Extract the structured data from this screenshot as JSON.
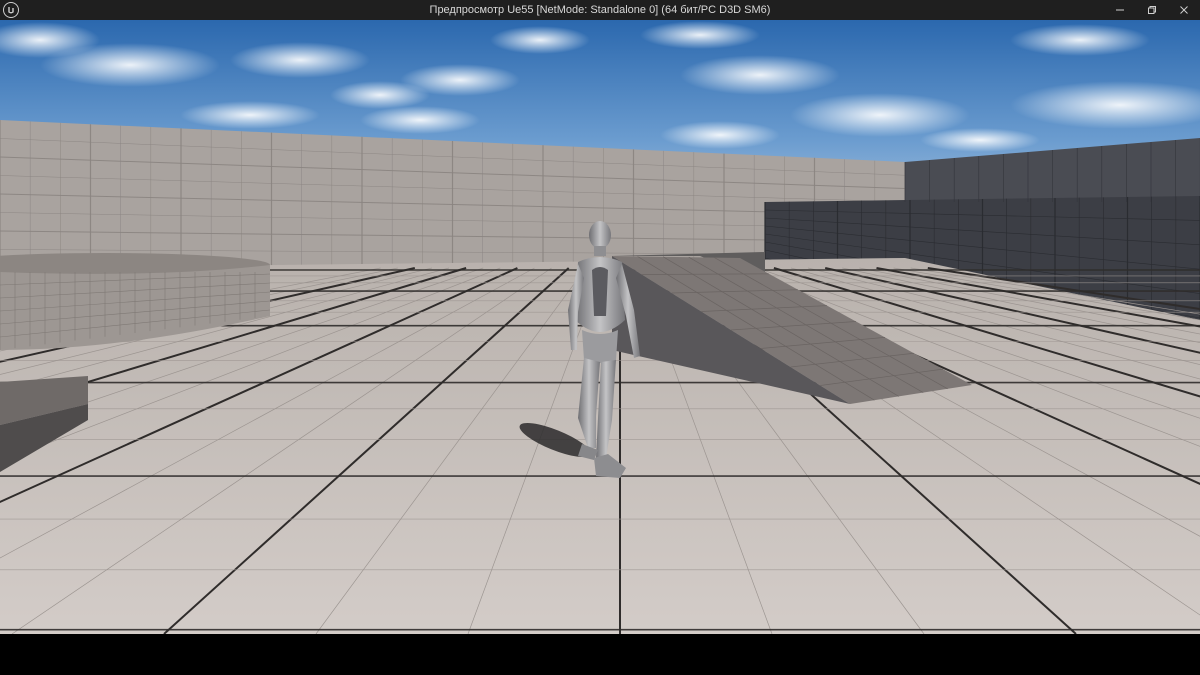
{
  "window": {
    "title": "Предпросмотр Ue55 [NetMode: Standalone 0]  (64 бит/PC D3D SM6)",
    "logo_icon": "unreal-engine-logo",
    "controls": [
      {
        "name": "minimize-button",
        "icon": "minimize-icon"
      },
      {
        "name": "restore-button",
        "icon": "restore-icon"
      },
      {
        "name": "close-button",
        "icon": "close-icon"
      }
    ]
  },
  "scene": {
    "description_icon": "game-viewport",
    "colors": {
      "sky_top": "#2f6fb4",
      "sky_bottom": "#8fb6dd",
      "floor": "#c9c1bd",
      "grid_major": "#3a3735",
      "wall_light": "#a8a29e",
      "wall_dark": "#3b3d44",
      "character": "#9a9a9c"
    }
  }
}
